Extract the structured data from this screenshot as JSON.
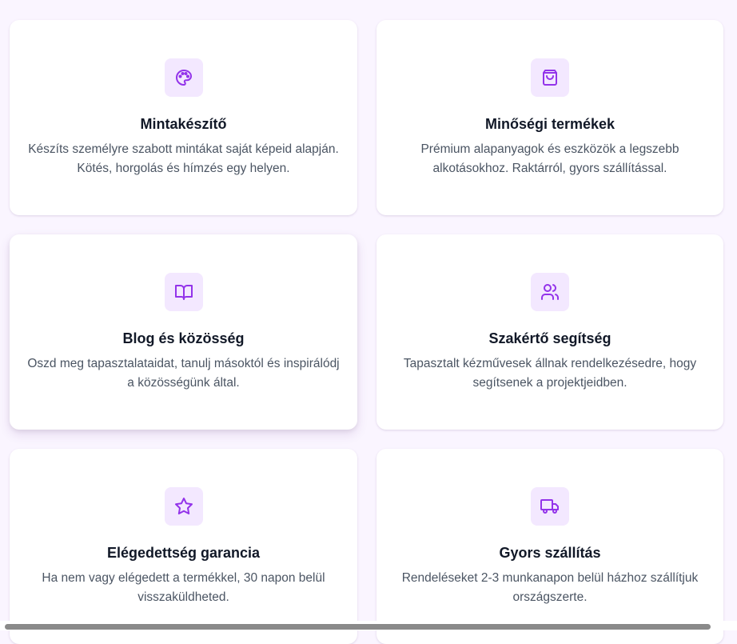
{
  "features": [
    {
      "icon": "palette-icon",
      "title": "Mintakészítő",
      "text": "Készíts személyre szabott mintákat saját képeid alapján. Kötés, horgolás és hímzés egy helyen."
    },
    {
      "icon": "shopping-bag-icon",
      "title": "Minőségi termékek",
      "text": "Prémium alapanyagok és eszközök a legszebb alkotásokhoz. Raktárról, gyors szállítással."
    },
    {
      "icon": "book-open-icon",
      "title": "Blog és közösség",
      "text": "Oszd meg tapasztalataidat, tanulj másoktól és inspirálódj a közösségünk által."
    },
    {
      "icon": "users-icon",
      "title": "Szakértő segítség",
      "text": "Tapasztalt kézművesek állnak rendelkezésedre, hogy segítsenek a projektjeidben."
    },
    {
      "icon": "star-icon",
      "title": "Elégedettség garancia",
      "text": "Ha nem vagy elégedett a termékkel, 30 napon belül visszaküldheted."
    },
    {
      "icon": "truck-icon",
      "title": "Gyors szállítás",
      "text": "Rendeléseket 2-3 munkanapon belül házhoz szállítjuk országszerte."
    }
  ],
  "colors": {
    "page_background": "#faf5ff",
    "icon_background": "#f3e8ff",
    "icon_stroke": "#9333ea",
    "title": "#111827",
    "body_text": "#4b5563"
  }
}
